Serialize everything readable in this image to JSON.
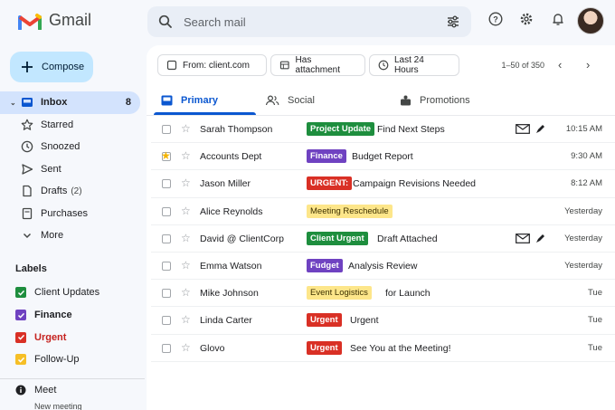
{
  "app": {
    "name": "Gmail",
    "brand_colors": {
      "red": "#ea4335",
      "blue": "#4285f4",
      "green": "#34a853",
      "yellow": "#fbbc04"
    }
  },
  "search": {
    "placeholder": "Search mail",
    "icon": "search-icon",
    "options_icon": "tune-icon"
  },
  "header_icons": [
    "help-icon",
    "settings-gear-icon",
    "notifications-bell-icon",
    "account-avatar"
  ],
  "compose": {
    "label": "Compose",
    "icon": "plus-icon"
  },
  "nav": [
    {
      "label": "Inbox",
      "count": "8",
      "icon": "inbox-icon",
      "active": true
    },
    {
      "label": "Starred",
      "icon": "star-icon"
    },
    {
      "label": "Snoozed",
      "icon": "clock-icon"
    },
    {
      "label": "Sent",
      "icon": "send-icon"
    },
    {
      "label": "Drafts",
      "count_inline": "(2)",
      "icon": "draft-icon"
    },
    {
      "label": "Purchases",
      "icon": "tag-icon"
    },
    {
      "label": "More",
      "icon": "chevron-down-icon"
    }
  ],
  "labels": {
    "title": "Labels",
    "items": [
      {
        "label": "Client Updates",
        "color": "#1e8e3e",
        "bold": false
      },
      {
        "label": "Finance",
        "color": "#6f42c1",
        "bold": true
      },
      {
        "label": "Urgent",
        "color": "#d93025",
        "bold": true
      },
      {
        "label": "Follow-Up",
        "color": "#f6bf26",
        "bold": false
      }
    ]
  },
  "meet": {
    "label": "Meet",
    "sub": "New meeting",
    "icon": "info-icon"
  },
  "filters": [
    {
      "label": "From: client.com",
      "icon": "person-icon"
    },
    {
      "label": "Has attachment",
      "icon": "attachment-icon"
    },
    {
      "label": "Last 24 Hours",
      "icon": "clock-icon"
    }
  ],
  "pager": {
    "text": "1–50 of 350"
  },
  "tabs": [
    {
      "label": "Primary",
      "icon": "inbox-icon",
      "active": true
    },
    {
      "label": "Social",
      "icon": "people-icon"
    },
    {
      "label": "Promotions",
      "icon": "promotions-tag-icon"
    }
  ],
  "emails": [
    {
      "sender": "Sarah Thompson",
      "tag": "Project Update",
      "tag_bg": "#1e8e3e",
      "tag_fg": "#ffffff",
      "subject": "Find Next Steps",
      "date": "10:15 AM",
      "starred": false,
      "has_icons": true
    },
    {
      "sender": "Accounts Dept",
      "tag": "Finance",
      "tag_bg": "#6f42c1",
      "tag_fg": "#ffffff",
      "subject": "Budget Report",
      "date": "9:30 AM",
      "starred": true,
      "has_icons": false
    },
    {
      "sender": "Jason Miller",
      "tag": "URGENT:",
      "tag_bg": "#d93025",
      "tag_fg": "#ffffff",
      "subject": "Campaign Revisions Needed",
      "date": "8:12 AM",
      "starred": false,
      "has_icons": false
    },
    {
      "sender": "Alice Reynolds",
      "tag": "Meeting Reschedule",
      "tag_bg": "#fde68a",
      "tag_fg": "#3c3000",
      "subject": "",
      "date": "Yesterday",
      "starred": false,
      "has_icons": false
    },
    {
      "sender": "David @ ClientCorp",
      "tag": "Client Urgent",
      "tag_bg": "#1e8e3e",
      "tag_fg": "#ffffff",
      "subject": "Draft Attached",
      "date": "Yesterday",
      "starred": false,
      "has_icons": true
    },
    {
      "sender": "Emma Watson",
      "tag": "Fudget",
      "tag_bg": "#6f42c1",
      "tag_fg": "#ffffff",
      "subject": "Analysis Review",
      "date": "Yesterday",
      "starred": false,
      "has_icons": false
    },
    {
      "sender": "Mike Johnson",
      "tag": "Event Logistics",
      "tag_bg": "#fde68a",
      "tag_fg": "#3c3000",
      "subject": "for Launch",
      "date": "Tue",
      "starred": false,
      "has_icons": false
    },
    {
      "sender": "Linda Carter",
      "tag": "Urgent",
      "tag_bg": "#d93025",
      "tag_fg": "#ffffff",
      "subject": "Urgent",
      "date": "Tue",
      "starred": false,
      "has_icons": false
    },
    {
      "sender": "Glovo",
      "tag": "Urgent",
      "tag_bg": "#d93025",
      "tag_fg": "#ffffff",
      "subject": "See You at the Meeting!",
      "date": "Tue",
      "starred": false,
      "has_icons": false
    }
  ]
}
